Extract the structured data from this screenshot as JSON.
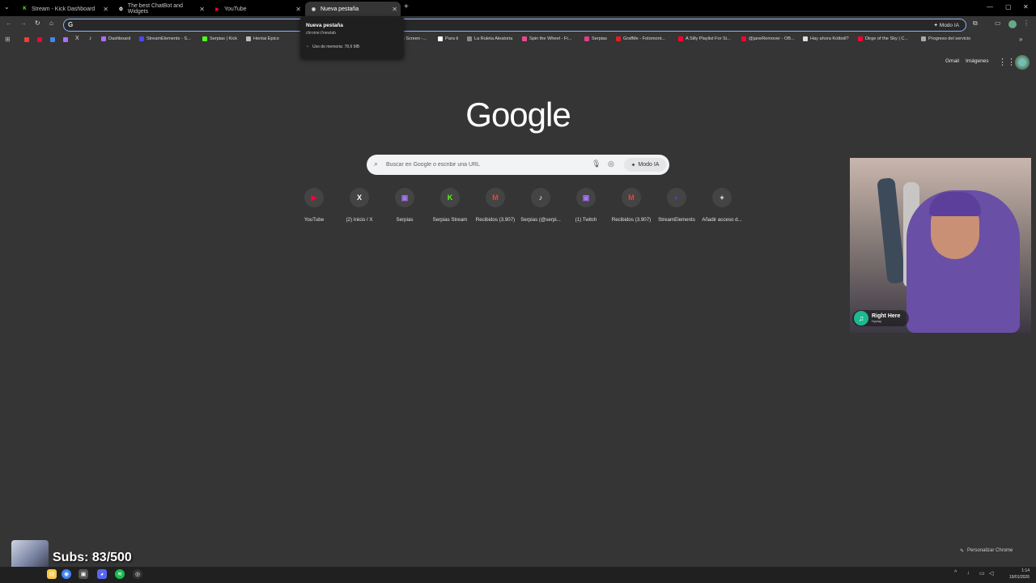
{
  "tabs": [
    {
      "label": "Stream - Kick Dashboard",
      "fav_color": "#53fc18",
      "fav_glyph": "K"
    },
    {
      "label": "The best ChatBot and Widgets",
      "fav_color": "#ffffff",
      "fav_glyph": "⚙"
    },
    {
      "label": "YouTube",
      "fav_color": "#ff0033",
      "fav_glyph": "▶"
    },
    {
      "label": "Nueva pestaña",
      "fav_color": "#dddddd",
      "fav_glyph": "◉"
    }
  ],
  "tooltip": {
    "title": "Nueva pestaña",
    "url": "chrome://newtab",
    "memory": "Uso de memoria: 78,6 MB"
  },
  "omnibox": {
    "mode_label": "Modo IA"
  },
  "bookmarks": [
    {
      "label": "Dashboard",
      "color": "#a970ff"
    },
    {
      "label": "StreamElements - S...",
      "color": "#4b48f0"
    },
    {
      "label": "Serpias | Kick",
      "color": "#53fc18"
    },
    {
      "label": "Hentai Epico",
      "color": "#bbbbbb"
    },
    {
      "label": "m Screen -...",
      "color": "#aaaaaa"
    },
    {
      "label": "Para ti",
      "color": "#ffffff"
    },
    {
      "label": "La Ruleta Aleatoria",
      "color": "#888888"
    },
    {
      "label": "Spin the Wheel - Fr...",
      "color": "#e94b8a"
    },
    {
      "label": "Serpias",
      "color": "#e23c8b"
    },
    {
      "label": "GrafMe - Fotomont...",
      "color": "#e02020"
    },
    {
      "label": "A Silly Playlist For Si...",
      "color": "#ff0033"
    },
    {
      "label": "@janeRemover - OB...",
      "color": "#ff0033"
    },
    {
      "label": "Hay ahora Kotboll?",
      "color": "#dddddd"
    },
    {
      "label": "Dirge of the Sky | C...",
      "color": "#ff0033"
    },
    {
      "label": "Progreso del servicio",
      "color": "#aaaaaa"
    }
  ],
  "header_links": {
    "gmail": "Gmail",
    "images": "Imágenes"
  },
  "logo": "Google",
  "search": {
    "placeholder": "Buscar en Google o escribir una URL",
    "ai_mode": "Modo IA"
  },
  "shortcuts": [
    {
      "label": "YouTube",
      "color": "#ff0033",
      "glyph": "▶"
    },
    {
      "label": "(2) Inicio / X",
      "color": "#ffffff",
      "glyph": "X"
    },
    {
      "label": "Serpias",
      "color": "#a970ff",
      "glyph": "▣"
    },
    {
      "label": "Serpias Stream",
      "color": "#53fc18",
      "glyph": "K"
    },
    {
      "label": "Recibidos (3.907)",
      "color": "#ea4335",
      "glyph": "M"
    },
    {
      "label": "Serpias (@serpi...",
      "color": "#ffffff",
      "glyph": "♪"
    },
    {
      "label": "(1) Twitch",
      "color": "#a970ff",
      "glyph": "▣"
    },
    {
      "label": "Recibidos (3.907)",
      "color": "#ea4335",
      "glyph": "M"
    },
    {
      "label": "StreamElements",
      "color": "#4b48f0",
      "glyph": "◐"
    },
    {
      "label": "Añadir acceso d...",
      "color": "#ffffff",
      "glyph": "+"
    }
  ],
  "now_playing": {
    "title": "Right Here",
    "artist": "Hyway"
  },
  "customize_label": "Personalizar Chrome",
  "subs": "Subs: 83/500",
  "clock": {
    "time": "1:14",
    "date": "19/01/2026"
  }
}
